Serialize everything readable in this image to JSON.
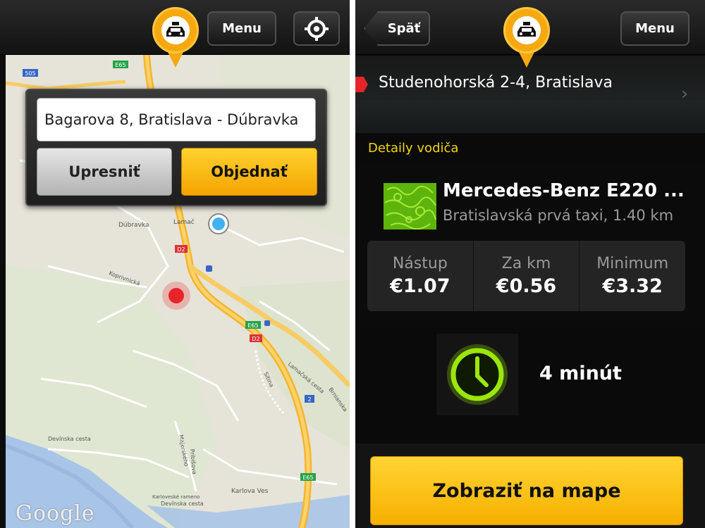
{
  "left_screen": {
    "menu_label": "Menu",
    "search_value": "Bagarova 8, Bratislava - Dúbravka",
    "refine_label": "Upresniť",
    "order_label": "Objednať",
    "map_labels": {
      "road_505": "505",
      "road_e65_a": "E65",
      "road_e65_b": "E65",
      "road_e65_c": "E65",
      "road_d2_a": "D2",
      "road_d2_b": "D2",
      "road_2": "2",
      "dubravka": "Dúbravka",
      "lamac": "Lamač",
      "koprivnicka": "Koprivnická",
      "lamacska": "Lamačská cesta",
      "brnianska": "Brnianska",
      "sitina": "Sitina",
      "devinska_a": "Devínska cesta",
      "devinska_b": "Devínska cesta",
      "karlova_ves": "Karlova Ves",
      "karlovske_rameno": "Karloveské rameno",
      "majerskeho": "Majerského",
      "pribisova": "Pribišova"
    },
    "google_logo": "Google"
  },
  "right_screen": {
    "back_label": "Späť",
    "menu_label": "Menu",
    "address": "Studenohorská 2-4, Bratislava",
    "section_title": "Detaily vodiča",
    "car_name": "Mercedes-Benz E220 ...",
    "car_sub": "Bratislavská prvá taxi, 1.40 km",
    "fares": [
      {
        "label": "Nástup",
        "value": "€1.07"
      },
      {
        "label": "Za km",
        "value": "€0.56"
      },
      {
        "label": "Minimum",
        "value": "€3.32"
      }
    ],
    "eta": "4 minút",
    "show_map_label": "Zobraziť na mape"
  },
  "colors": {
    "accent_yellow": "#f6a90f",
    "section_yellow": "#f2d600",
    "clock_green": "#9be60b",
    "marker_red": "#e8242b"
  },
  "icons": {
    "taxi": "taxi-icon",
    "locate": "crosshair-icon",
    "clock": "clock-icon",
    "chevron": "chevron-right-icon"
  }
}
